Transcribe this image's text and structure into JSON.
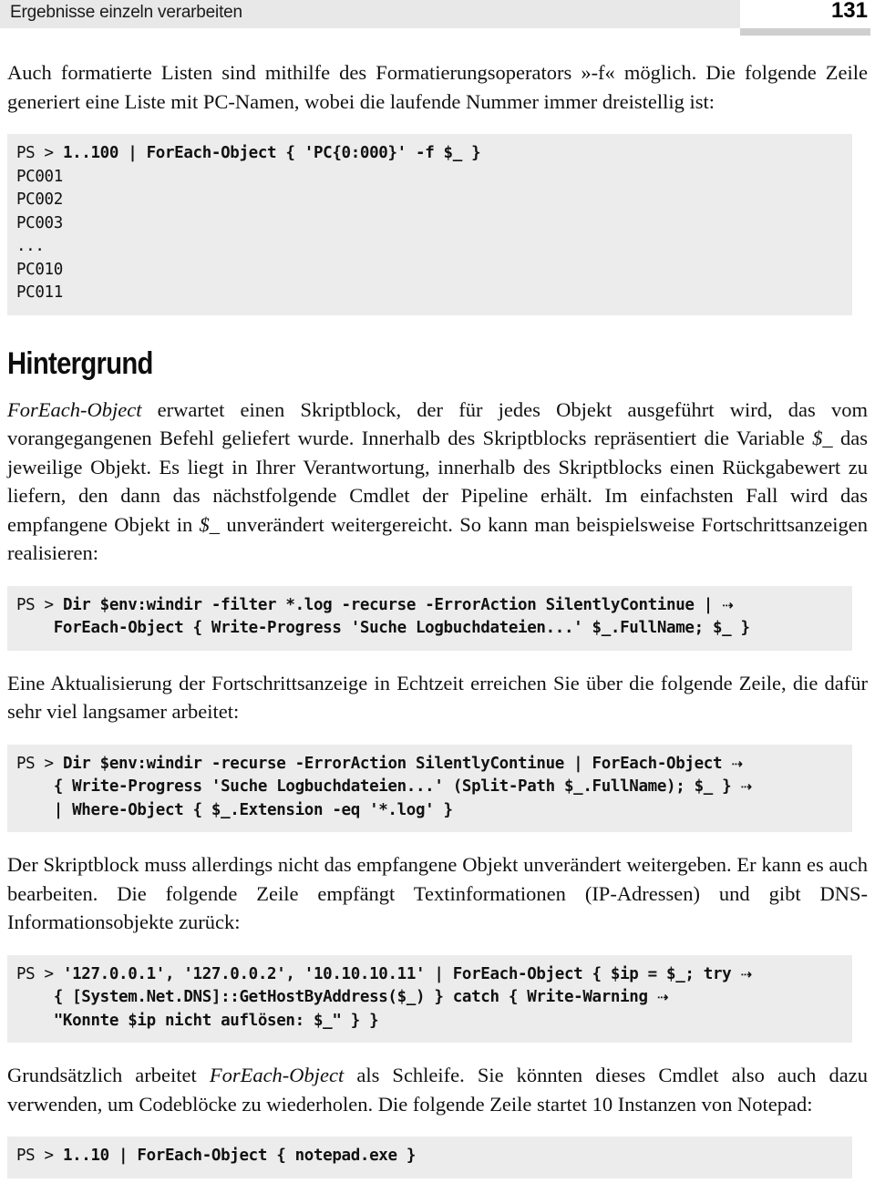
{
  "header": {
    "running_title": "Ergebnisse einzeln verarbeiten",
    "page_number": "131"
  },
  "content": {
    "intro_paragraph": "Auch formatierte Listen sind mithilfe des Formatierungsoperators »-f« möglich. Die folgende Zeile generiert eine Liste mit PC-Namen, wobei die laufende Nummer immer dreistellig ist:",
    "code_block_1": {
      "prompt": "PS > ",
      "command": "1..100 | ForEach-Object { 'PC{0:000}' -f $_ }",
      "output": "PC001\nPC002\nPC003\n...\nPC010\nPC011"
    },
    "section_heading": "Hintergrund",
    "background_paragraph": {
      "lead_italic": "ForEach-Object",
      "part_1": " erwartet einen Skriptblock, der für jedes Objekt ausgeführt wird, das vom vorangegangenen Befehl geliefert wurde. Innerhalb des Skriptblocks repräsentiert die Variable ",
      "var_1": "$_",
      "part_2": " das jeweilige Objekt. Es liegt in Ihrer Verantwortung, innerhalb des Skriptblocks einen Rückgabewert zu liefern, den dann das nächstfolgende Cmdlet der Pipeline erhält. Im einfachsten Fall wird das empfangene Objekt in ",
      "var_2": "$_",
      "part_3": " unverändert weitergereicht. So kann man beispielsweise Fortschrittsanzeigen realisieren:"
    },
    "code_block_2": {
      "prompt": "PS > ",
      "line_1": "Dir $env:windir -filter *.log -recurse -ErrorAction SilentlyContinue | ",
      "line_1_arrow": "⇢",
      "line_2": "    ForEach-Object { Write-Progress 'Suche Logbuchdateien...' $_.FullName; $_ }"
    },
    "realtime_paragraph": "Eine Aktualisierung der Fortschrittsanzeige in Echtzeit erreichen Sie über die folgende Zeile, die dafür sehr viel langsamer arbeitet:",
    "code_block_3": {
      "prompt": "PS > ",
      "line_1": "Dir $env:windir -recurse -ErrorAction SilentlyContinue | ForEach-Object ",
      "line_1_arrow": "⇢",
      "line_2": "    { Write-Progress 'Suche Logbuchdateien...' (Split-Path $_.FullName); $_ } ",
      "line_2_arrow": "⇢",
      "line_3": "    | Where-Object { $_.Extension -eq '*.log' }"
    },
    "modify_paragraph": "Der Skriptblock muss allerdings nicht das empfangene Objekt unverändert weitergeben. Er kann es auch bearbeiten. Die folgende Zeile empfängt Textinformationen (IP-Adressen) und gibt DNS-Informationsobjekte zurück:",
    "code_block_4": {
      "prompt": "PS > ",
      "line_1": "'127.0.0.1', '127.0.0.2', '10.10.10.11' | ForEach-Object { $ip = $_; try ",
      "line_1_arrow": "⇢",
      "line_2": "    { [System.Net.DNS]::GetHostByAddress($_) } catch { Write-Warning ",
      "line_2_arrow": "⇢",
      "line_3": "    \"Konnte $ip nicht auflösen: $_\" } }"
    },
    "loop_paragraph": {
      "part_1": "Grundsätzlich arbeitet ",
      "italic": "ForEach-Object",
      "part_2": " als Schleife. Sie könnten dieses Cmdlet also auch dazu verwenden, um Codeblöcke zu wiederholen. Die folgende Zeile startet 10 Instanzen von Notepad:"
    },
    "code_block_5": {
      "prompt": "PS > ",
      "command": "1..10 | ForEach-Object { notepad.exe }"
    }
  },
  "colors": {
    "code_background": "#ececec",
    "header_band": "#e8e8e8",
    "header_rule": "#cfcfcf",
    "text": "#111111"
  }
}
